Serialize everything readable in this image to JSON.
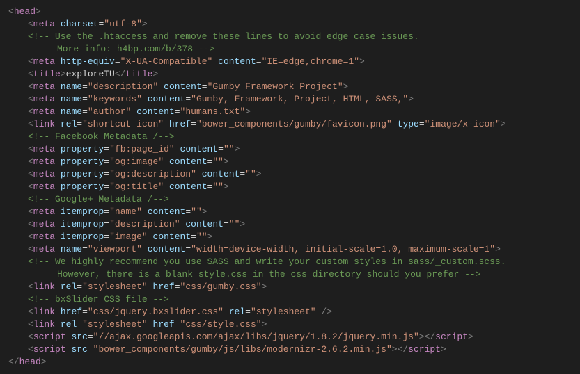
{
  "l1": {
    "tag": "head"
  },
  "l2": {
    "tag": "meta",
    "a1": "charset",
    "v1": "utf-8"
  },
  "l3": {
    "text": "<!-- Use the .htaccess and remove these lines to avoid edge case issues."
  },
  "l4": {
    "text": "More info: h4bp.com/b/378 -->"
  },
  "l5": {
    "tag": "meta",
    "a1": "http-equiv",
    "v1": "X-UA-Compatible",
    "a2": "content",
    "v2": "IE=edge,chrome=1"
  },
  "l6": {
    "tag": "title",
    "text": "exploreTU"
  },
  "l7": {
    "tag": "meta",
    "a1": "name",
    "v1": "description",
    "a2": "content",
    "v2": "Gumby Framework Project"
  },
  "l8": {
    "tag": "meta",
    "a1": "name",
    "v1": "keywords",
    "a2": "content",
    "v2": "Gumby, Framework, Project, HTML, SASS,"
  },
  "l9": {
    "tag": "meta",
    "a1": "name",
    "v1": "author",
    "a2": "content",
    "v2": "humans.txt"
  },
  "l10": {
    "tag": "link",
    "a1": "rel",
    "v1": "shortcut icon",
    "a2": "href",
    "v2": "bower_components/gumby/favicon.png",
    "a3": "type",
    "v3": "image/x-icon"
  },
  "l11": {
    "text": "<!-- Facebook Metadata /-->"
  },
  "l12": {
    "tag": "meta",
    "a1": "property",
    "v1": "fb:page_id",
    "a2": "content",
    "v2": ""
  },
  "l13": {
    "tag": "meta",
    "a1": "property",
    "v1": "og:image",
    "a2": "content",
    "v2": ""
  },
  "l14": {
    "tag": "meta",
    "a1": "property",
    "v1": "og:description",
    "a2": "content",
    "v2": ""
  },
  "l15": {
    "tag": "meta",
    "a1": "property",
    "v1": "og:title",
    "a2": "content",
    "v2": ""
  },
  "l16": {
    "text": "<!-- Google+ Metadata /-->"
  },
  "l17": {
    "tag": "meta",
    "a1": "itemprop",
    "v1": "name",
    "a2": "content",
    "v2": ""
  },
  "l18": {
    "tag": "meta",
    "a1": "itemprop",
    "v1": "description",
    "a2": "content",
    "v2": ""
  },
  "l19": {
    "tag": "meta",
    "a1": "itemprop",
    "v1": "image",
    "a2": "content",
    "v2": ""
  },
  "l20": {
    "tag": "meta",
    "a1": "name",
    "v1": "viewport",
    "a2": "content",
    "v2": "width=device-width, initial-scale=1.0, maximum-scale=1"
  },
  "l21": {
    "text": "<!-- We highly recommend you use SASS and write your custom styles in sass/_custom.scss."
  },
  "l22": {
    "text": "However, there is a blank style.css in the css directory should you prefer -->"
  },
  "l23": {
    "tag": "link",
    "a1": "rel",
    "v1": "stylesheet",
    "a2": "href",
    "v2": "css/gumby.css"
  },
  "l24": {
    "text": "<!-- bxSlider CSS file -->"
  },
  "l25": {
    "tag": "link",
    "a1": "href",
    "v1": "css/jquery.bxslider.css",
    "a2": "rel",
    "v2": "stylesheet"
  },
  "l26": {
    "tag": "link",
    "a1": "rel",
    "v1": "stylesheet",
    "a2": "href",
    "v2": "css/style.css"
  },
  "l27": {
    "tag": "script",
    "a1": "src",
    "v1": "//ajax.googleapis.com/ajax/libs/jquery/1.8.2/jquery.min.js"
  },
  "l28": {
    "tag": "script",
    "a1": "src",
    "v1": "bower_components/gumby/js/libs/modernizr-2.6.2.min.js"
  },
  "l29": {
    "tag": "head"
  }
}
